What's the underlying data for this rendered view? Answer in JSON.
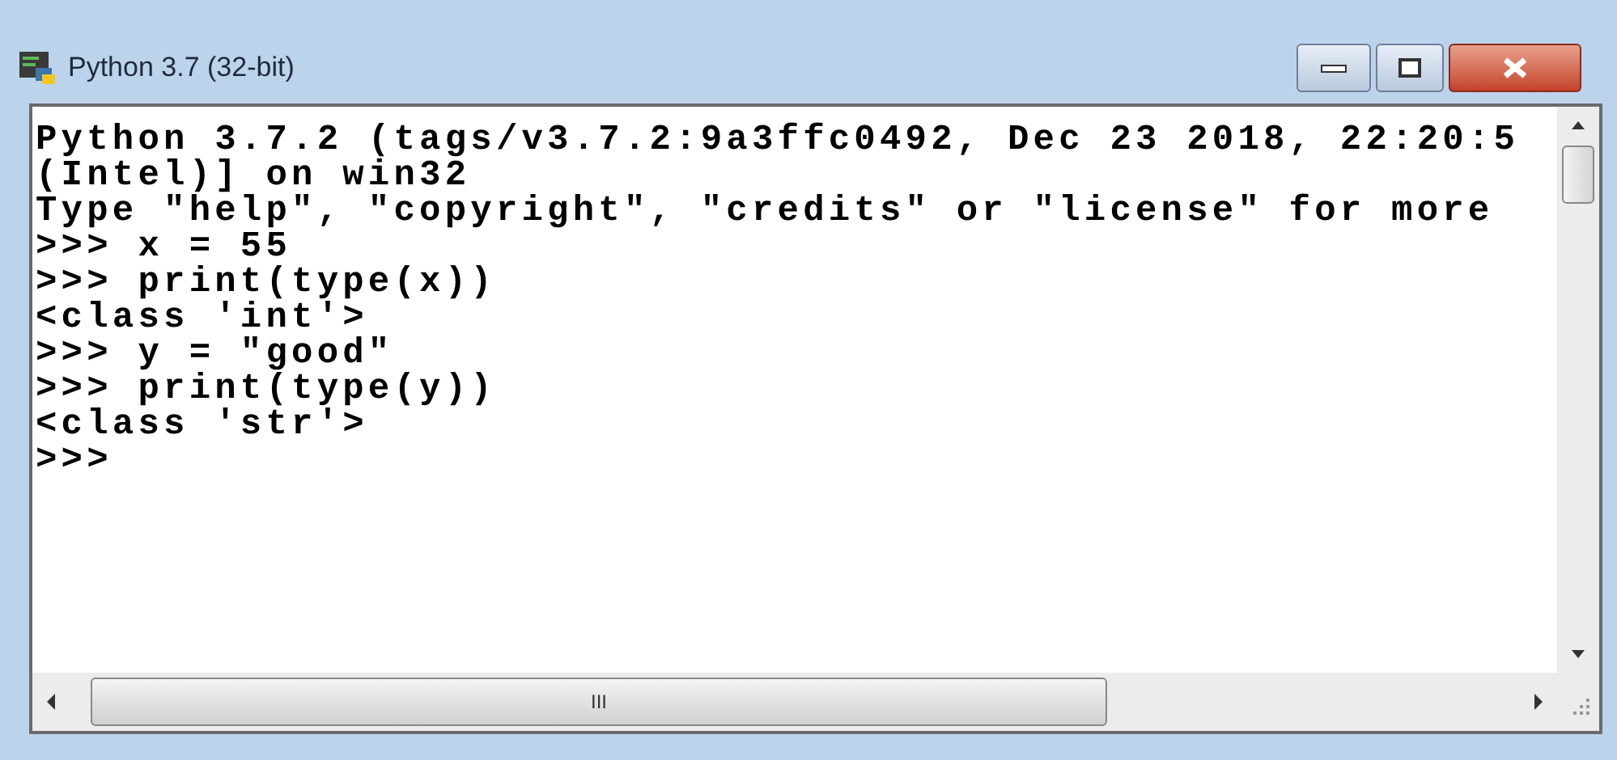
{
  "window": {
    "title": "Python 3.7 (32-bit)"
  },
  "console": {
    "lines": [
      "Python 3.7.2 (tags/v3.7.2:9a3ffc0492, Dec 23 2018, 22:20:5",
      "(Intel)] on win32",
      "Type \"help\", \"copyright\", \"credits\" or \"license\" for more",
      ">>> x = 55",
      ">>> print(type(x))",
      "<class 'int'>",
      ">>> y = \"good\"",
      ">>> print(type(y))",
      "<class 'str'>",
      ">>>"
    ]
  },
  "horizontal_scrollbar": {
    "grip": "III"
  }
}
